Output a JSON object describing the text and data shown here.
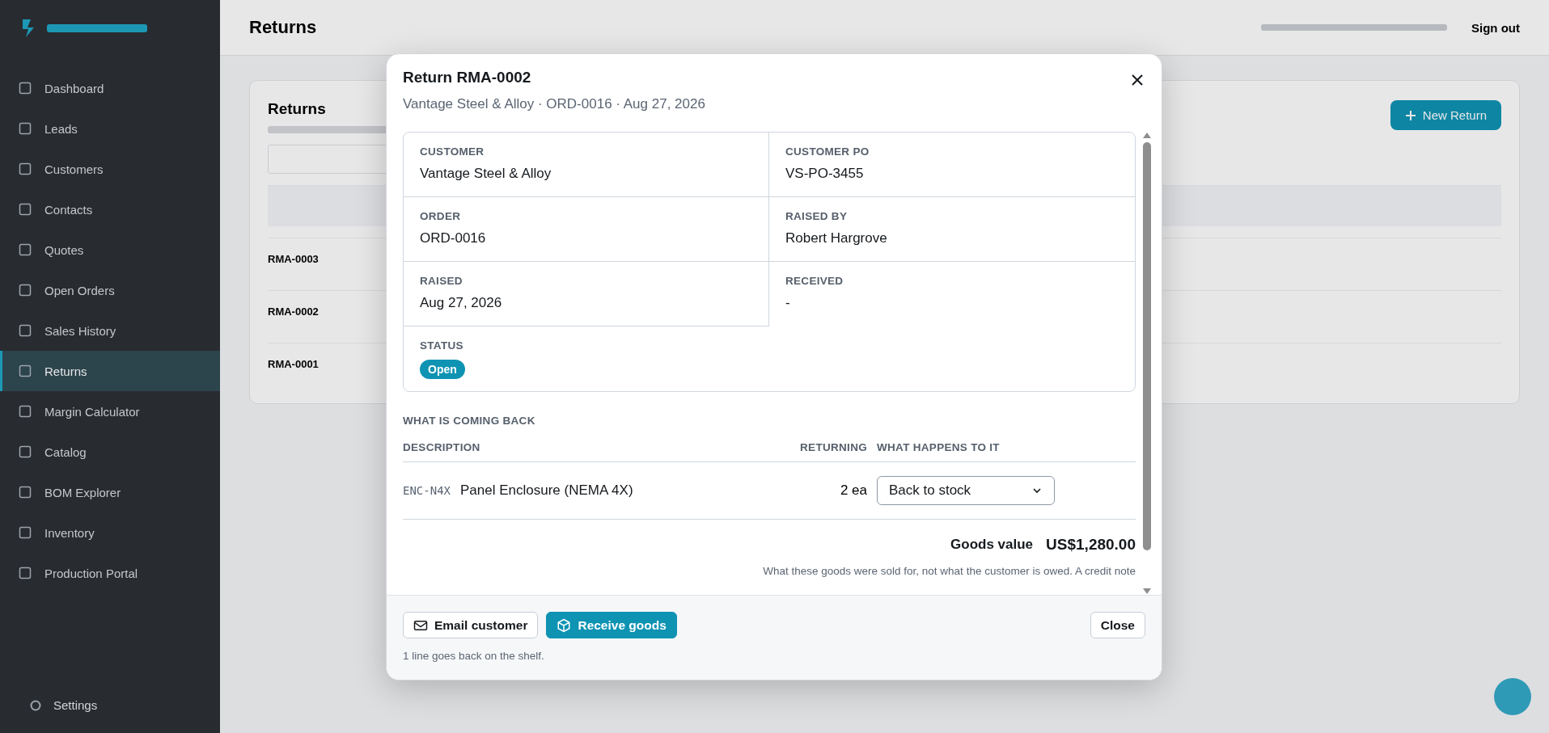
{
  "sidebar": {
    "items": [
      {
        "label": "Dashboard",
        "selected": false
      },
      {
        "label": "Leads",
        "selected": false
      },
      {
        "label": "Customers",
        "selected": false
      },
      {
        "label": "Contacts",
        "selected": false
      },
      {
        "label": "Quotes",
        "selected": false
      },
      {
        "label": "Open Orders",
        "selected": false
      },
      {
        "label": "Sales History",
        "selected": false
      },
      {
        "label": "Returns",
        "selected": true
      },
      {
        "label": "Margin Calculator",
        "selected": false
      },
      {
        "label": "Catalog",
        "selected": false
      },
      {
        "label": "BOM Explorer",
        "selected": false
      },
      {
        "label": "Inventory",
        "selected": false
      },
      {
        "label": "Production Portal",
        "selected": false
      }
    ],
    "settings": "Settings"
  },
  "header": {
    "title": "Returns",
    "sign_out": "Sign out"
  },
  "page_card": {
    "title": "Returns",
    "button": "New Return",
    "rows": [
      "RMA-0003",
      "RMA-0002",
      "RMA-0001"
    ]
  },
  "modal": {
    "title": "Return RMA-0002",
    "subtitle": "Vantage Steel & Alloy · ORD-0016 · Aug 27, 2026",
    "details": [
      {
        "label": "CUSTOMER",
        "value": "Vantage Steel & Alloy",
        "kind": "text"
      },
      {
        "label": "CUSTOMER PO",
        "value": "VS-PO-3455",
        "kind": "text"
      },
      {
        "label": "ORDER",
        "value": "ORD-0016",
        "kind": "text"
      },
      {
        "label": "RAISED BY",
        "value": "Robert Hargrove",
        "kind": "text"
      },
      {
        "label": "RAISED",
        "value": "Aug 27, 2026",
        "kind": "text"
      },
      {
        "label": "RECEIVED",
        "value": "-",
        "kind": "text"
      },
      {
        "label": "STATUS",
        "value": "Open",
        "kind": "badge"
      }
    ],
    "section_title": "WHAT IS COMING BACK",
    "columns": [
      "DESCRIPTION",
      "RETURNING",
      "WHAT HAPPENS TO IT"
    ],
    "lines": [
      {
        "sku": "ENC-N4X",
        "description": "Panel Enclosure (NEMA 4X)",
        "returning": "2 ea",
        "action": "Back to stock"
      }
    ],
    "total": {
      "label": "Goods value",
      "value": "US$1,280.00"
    },
    "note": "What these goods were sold for, not what the customer is owed. A credit note",
    "actions": [
      {
        "label": "Email customer",
        "kind": "secondary"
      },
      {
        "label": "Receive goods",
        "kind": "primary"
      }
    ],
    "close_button": "Close",
    "footer_note": "1 line goes back on the shelf."
  }
}
